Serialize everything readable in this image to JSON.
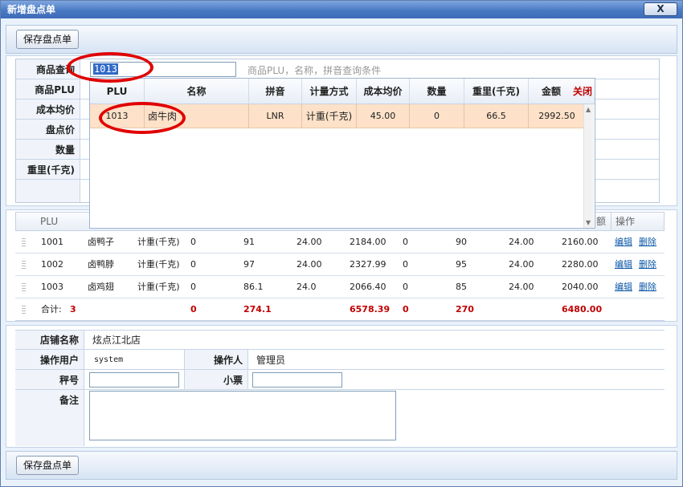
{
  "window": {
    "title": "新增盘点单",
    "close_label": "X"
  },
  "toolbar": {
    "save_label": "保存盘点单"
  },
  "form": {
    "search_label": "商品查询",
    "search_value": "1013",
    "search_hint": "商品PLU，名称，拼音查询条件",
    "labels": [
      "商品PLU",
      "成本均价",
      "盘点价",
      "数量",
      "重里(千克)"
    ]
  },
  "dropdown": {
    "headers": [
      "PLU",
      "名称",
      "拼音",
      "计量方式",
      "成本均价",
      "数量",
      "重里(千克)",
      "金额"
    ],
    "close_label": "关闭",
    "row": [
      "1013",
      "卤牛肉",
      "LNR",
      "计重(千克)",
      "45.00",
      "0",
      "66.5",
      "2992.50"
    ]
  },
  "grid": {
    "headers": {
      "plu": "PLU",
      "amount_partial": "额",
      "ops": "操作"
    },
    "rows": [
      [
        "1001",
        "卤鸭子",
        "计重(千克)",
        "0",
        "91",
        "24.00",
        "2184.00",
        "0",
        "90",
        "24.00",
        "2160.00"
      ],
      [
        "1002",
        "卤鸭脖",
        "计重(千克)",
        "0",
        "97",
        "24.00",
        "2327.99",
        "0",
        "95",
        "24.00",
        "2280.00"
      ],
      [
        "1003",
        "卤鸡翅",
        "计重(千克)",
        "0",
        "86.1",
        "24.0",
        "2066.40",
        "0",
        "85",
        "24.00",
        "2040.00"
      ]
    ],
    "edit_label": "编辑",
    "delete_label": "删除",
    "summary": {
      "label": "合计:",
      "count": "3",
      "v1": "0",
      "v2": "274.1",
      "v3": "6578.39",
      "v4": "0",
      "v5": "270",
      "v6": "6480.00"
    }
  },
  "info": {
    "store_label": "店铺名称",
    "store_value": "炫点江北店",
    "user_label": "操作用户",
    "user_value": "system",
    "operator_label": "操作人",
    "operator_value": "管理员",
    "scale_label": "秤号",
    "ticket_label": "小票",
    "note_label": "备注"
  },
  "colors": {
    "accent_ring": "#e00000",
    "highlight_row": "#fde1c8",
    "sum_red": "#c00000"
  }
}
